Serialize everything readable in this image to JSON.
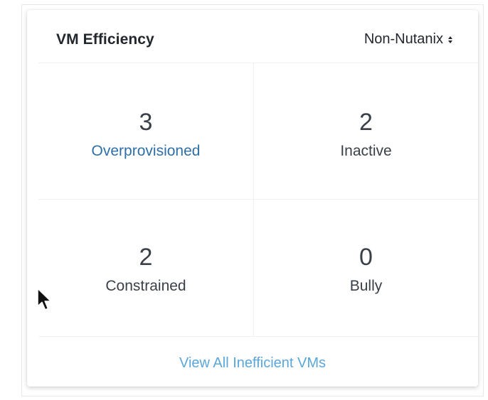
{
  "widget": {
    "title": "VM Efficiency",
    "filter": {
      "selected": "Non-Nutanix"
    },
    "close_glyph": "×",
    "cells": [
      {
        "count": "3",
        "label": "Overprovisioned"
      },
      {
        "count": "2",
        "label": "Inactive"
      },
      {
        "count": "2",
        "label": "Constrained"
      },
      {
        "count": "0",
        "label": "Bully"
      }
    ],
    "footer_link": "View All Inefficient VMs"
  },
  "icons": {
    "close": "close-icon",
    "sort": "sort-arrows-icon",
    "cursor": "mouse-pointer-icon"
  },
  "colors": {
    "title": "#22272e",
    "value": "#3a4048",
    "overprovisioned_label": "#2f6fa8",
    "footer_link": "#5aa6da",
    "divider": "#eef0f2"
  }
}
